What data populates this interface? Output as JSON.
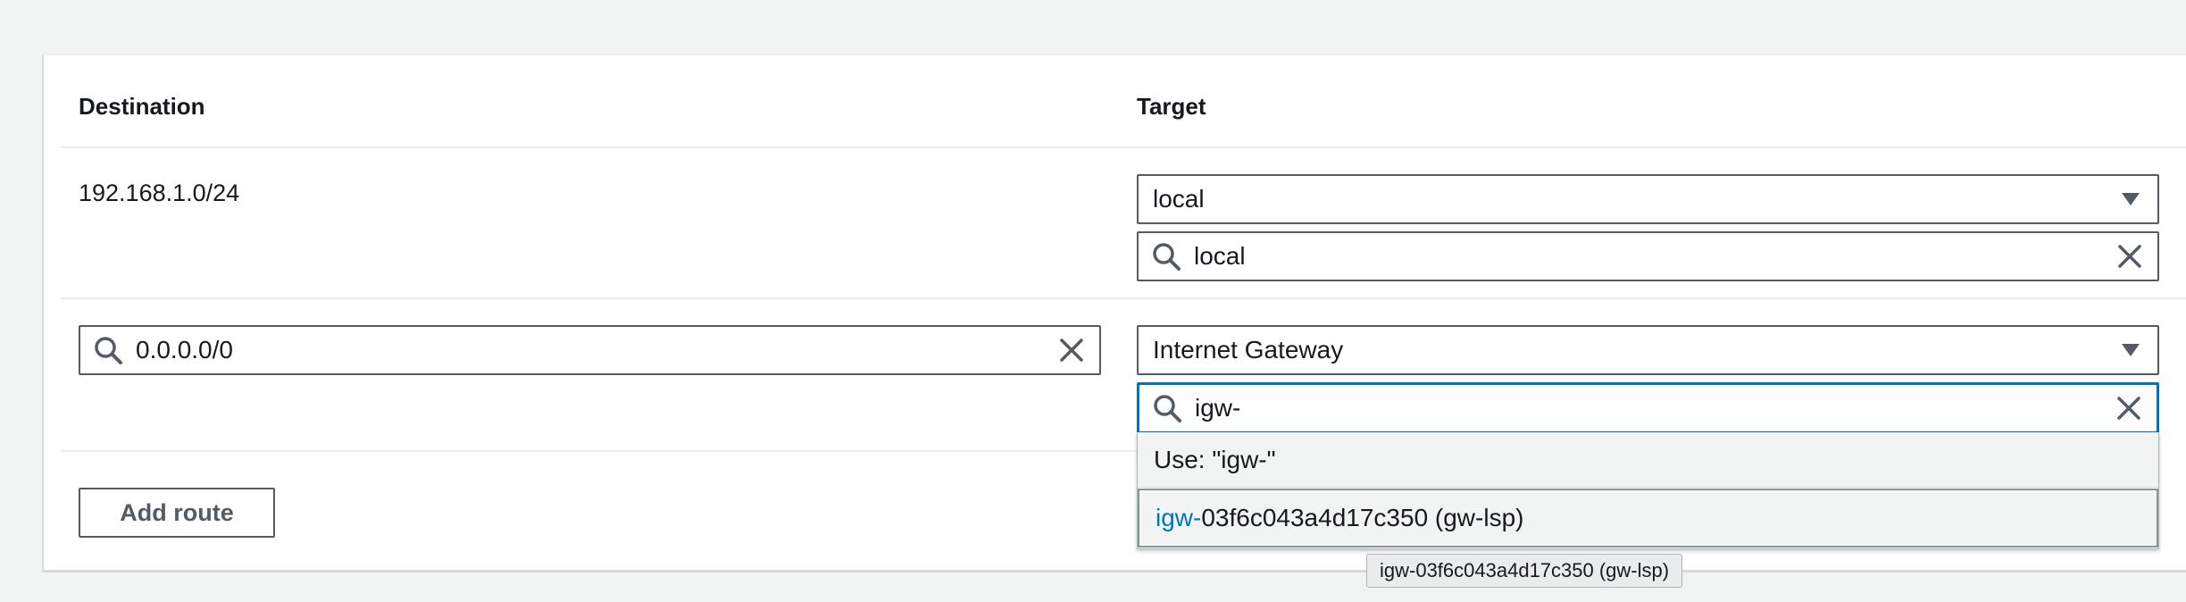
{
  "columns": {
    "destination": "Destination",
    "target": "Target"
  },
  "rows": [
    {
      "destination_text": "192.168.1.0/24",
      "target_type": "local",
      "target_search": "local"
    },
    {
      "destination_search": "0.0.0.0/0",
      "target_type": "Internet Gateway",
      "target_search": "igw-"
    }
  ],
  "dropdown": {
    "use_option": "Use: \"igw-\"",
    "match_highlight": "igw-",
    "match_rest": "03f6c043a4d17c350 (gw-lsp)"
  },
  "tooltip": "igw-03f6c043a4d17c350 (gw-lsp)",
  "add_route_label": "Add route",
  "colors": {
    "accent": "#0073bb",
    "border": "#545b64",
    "background": "#f2f3f3"
  },
  "icons": {
    "search": "search-icon",
    "clear": "close-icon",
    "caret": "caret-down-icon"
  }
}
